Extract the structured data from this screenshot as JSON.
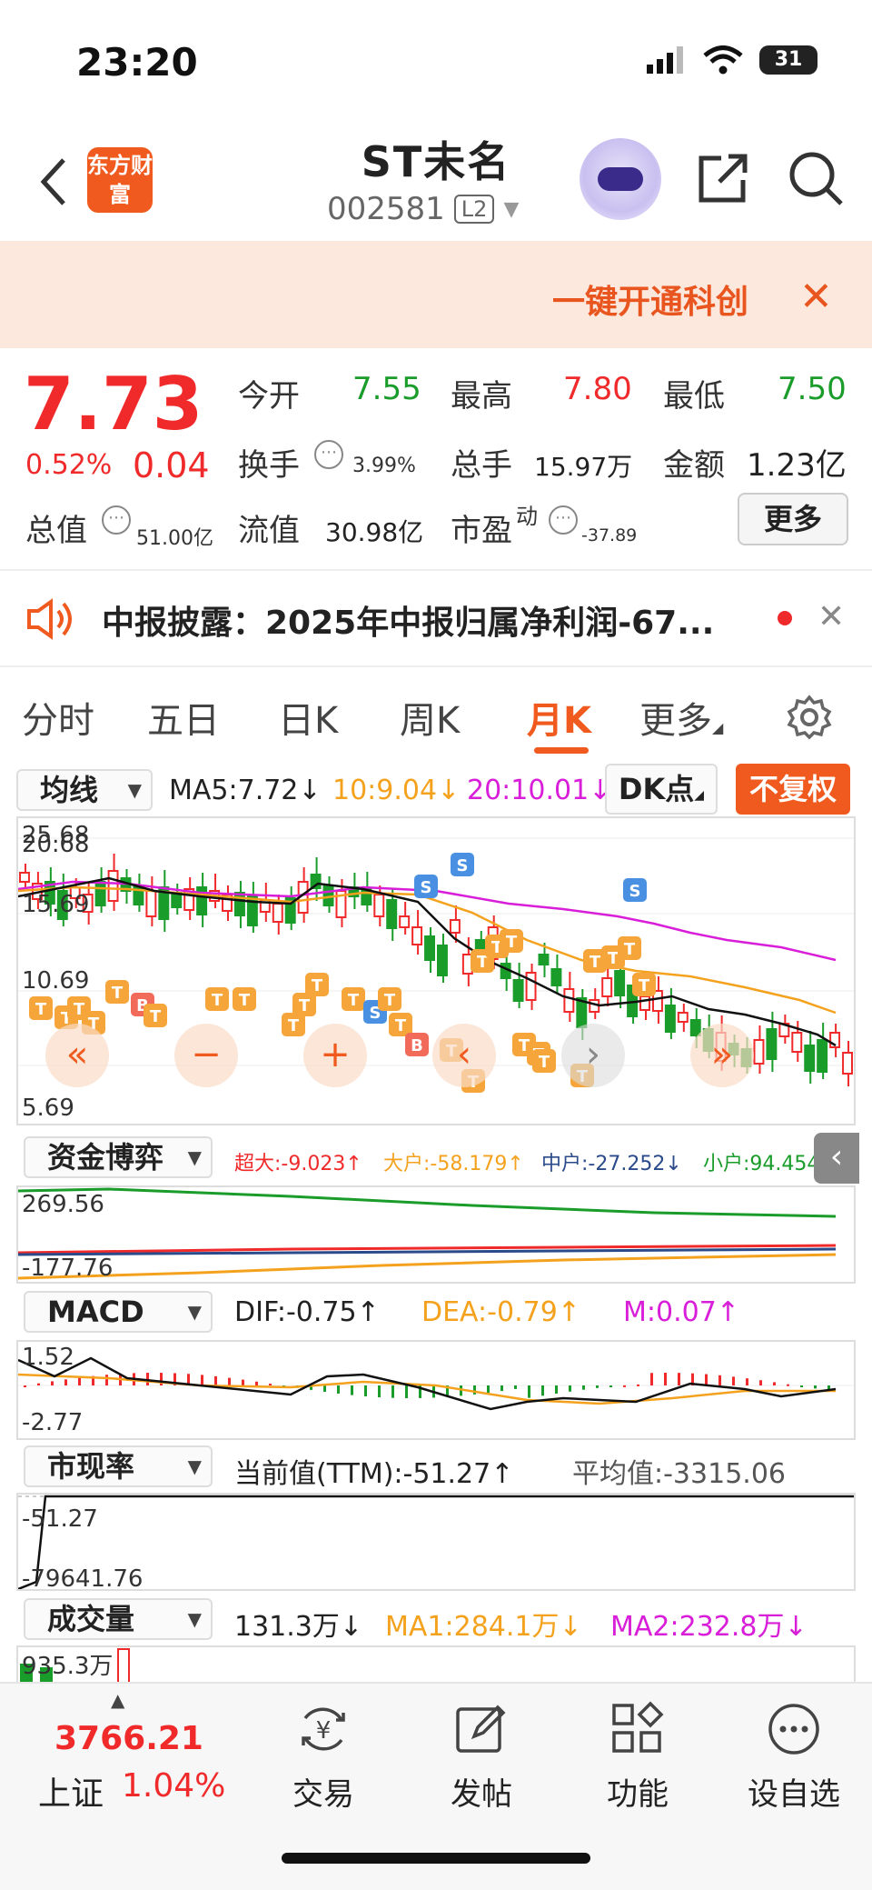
{
  "status_bar": {
    "time": "23:20",
    "battery": "31"
  },
  "header": {
    "logo_text": "东方财富",
    "stock_name": "ST未名",
    "stock_code": "002581",
    "level_badge": "L2"
  },
  "promo": {
    "text": "一键开通科创"
  },
  "quote": {
    "price": "7.73",
    "change_pct": "0.52%",
    "change": "0.04",
    "open_label": "今开",
    "open": "7.55",
    "high_label": "最高",
    "high": "7.80",
    "low_label": "最低",
    "low": "7.50",
    "turnover_label": "换手",
    "turnover": "3.99%",
    "volume_label": "总手",
    "volume": "15.97万",
    "amount_label": "金额",
    "amount": "1.23亿",
    "mktcap_label": "总值",
    "mktcap": "51.00亿",
    "float_label": "流值",
    "float": "30.98亿",
    "pe_label": "市盈",
    "pe_sup": "动",
    "pe": "-37.89",
    "more_label": "更多"
  },
  "news": {
    "text": "中报披露：2025年中报归属净利润-67..."
  },
  "tabs": [
    "分时",
    "五日",
    "日K",
    "周K",
    "月K",
    "更多"
  ],
  "active_tab": "月K",
  "ma_row": {
    "selector": "均线",
    "ma5": "MA5:7.72↓",
    "ma10": "10:9.04↓",
    "ma20": "20:10.01↓",
    "dk": "DK点",
    "adjust": "不复权"
  },
  "kchart": {
    "y_labels": [
      "25.68",
      "20.68",
      "15.69",
      "10.69",
      "5.69"
    ]
  },
  "capital_row": {
    "selector": "资金博弈",
    "super": "超大:-9.023↑",
    "large": "大户:-58.179↑",
    "mid": "中户:-27.252↓",
    "small": "小户:94.454",
    "y_top": "269.56",
    "y_bottom": "-177.76"
  },
  "macd_row": {
    "selector": "MACD",
    "dif": "DIF:-0.75↑",
    "dea": "DEA:-0.79↑",
    "m": "M:0.07↑",
    "y_top": "1.52",
    "y_bottom": "-2.77"
  },
  "pcf_row": {
    "selector": "市现率",
    "current": "当前值(TTM):-51.27↑",
    "average": "平均值:-3315.06",
    "y_top": "-51.27",
    "y_bottom": "-79641.76"
  },
  "vol_row": {
    "selector": "成交量",
    "vol": "131.3万↓",
    "ma1": "MA1:284.1万↓",
    "ma2": "MA2:232.8万↓",
    "y_top": "935.3万"
  },
  "bottom_bar": {
    "index_value": "3766.21",
    "index_name": "上证",
    "index_pct": "1.04%",
    "items": [
      "交易",
      "发帖",
      "功能",
      "设自选"
    ]
  },
  "colors": {
    "up": "#f02a2a",
    "down": "#1a9c2a",
    "accent": "#f05a1e",
    "ma10": "#f4a21e",
    "ma20": "#d81ed8"
  }
}
